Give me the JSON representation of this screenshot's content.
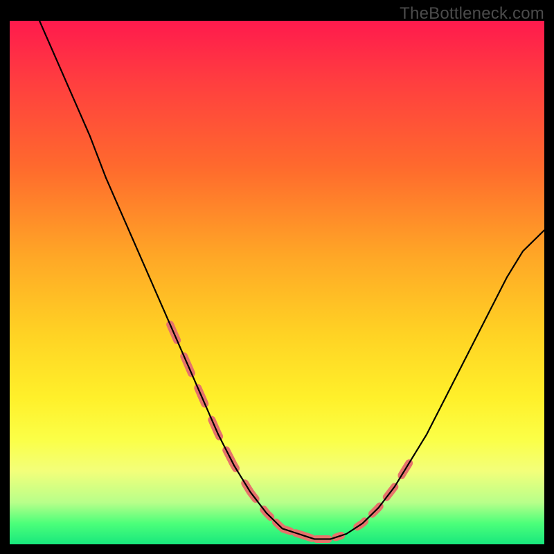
{
  "watermark": "TheBottleneck.com",
  "colors": {
    "background": "#000000",
    "gradient_top": "#ff1a4d",
    "gradient_bottom": "#18e87d",
    "curve": "#000000",
    "highlight": "#e6736b",
    "watermark_text": "#4b4b4b"
  },
  "chart_data": {
    "type": "line",
    "title": "",
    "xlabel": "",
    "ylabel": "",
    "xlim": [
      0,
      100
    ],
    "ylim": [
      0,
      100
    ],
    "grid": false,
    "legend": null,
    "note": "Axes are unlabeled in the source image; x and y are normalized 0-100. y=100 is the top of the gradient (red), y=0 the bottom (green). Values estimated visually.",
    "series": [
      {
        "name": "curve",
        "x": [
          0,
          3,
          6,
          9,
          12,
          15,
          18,
          21,
          24,
          27,
          30,
          33,
          36,
          39,
          42,
          45,
          48,
          51,
          54,
          57,
          60,
          63,
          66,
          69,
          72,
          75,
          78,
          81,
          84,
          87,
          90,
          93,
          96,
          100
        ],
        "y": [
          113,
          106,
          99,
          92,
          85,
          78,
          70,
          63,
          56,
          49,
          42,
          35,
          28,
          21,
          15,
          10,
          6,
          3,
          2,
          1,
          1,
          2,
          4,
          7,
          11,
          16,
          21,
          27,
          33,
          39,
          45,
          51,
          56,
          60
        ]
      }
    ],
    "highlight_segments": {
      "note": "short thick coral dashes overlaid on the curve near the trough; each segment given as [x_start, x_end] in same 0-100 x-units",
      "segments": [
        [
          30.0,
          31.3
        ],
        [
          32.6,
          34.0
        ],
        [
          35.2,
          36.5
        ],
        [
          37.8,
          39.2
        ],
        [
          40.5,
          42.3
        ],
        [
          44.0,
          46.0
        ],
        [
          47.5,
          48.8
        ],
        [
          49.8,
          52.5
        ],
        [
          53.5,
          56.5
        ],
        [
          57.4,
          59.6
        ],
        [
          61.0,
          62.0
        ],
        [
          65.0,
          66.4
        ],
        [
          67.8,
          69.2
        ],
        [
          70.5,
          72.0
        ],
        [
          73.3,
          74.7
        ]
      ]
    }
  }
}
